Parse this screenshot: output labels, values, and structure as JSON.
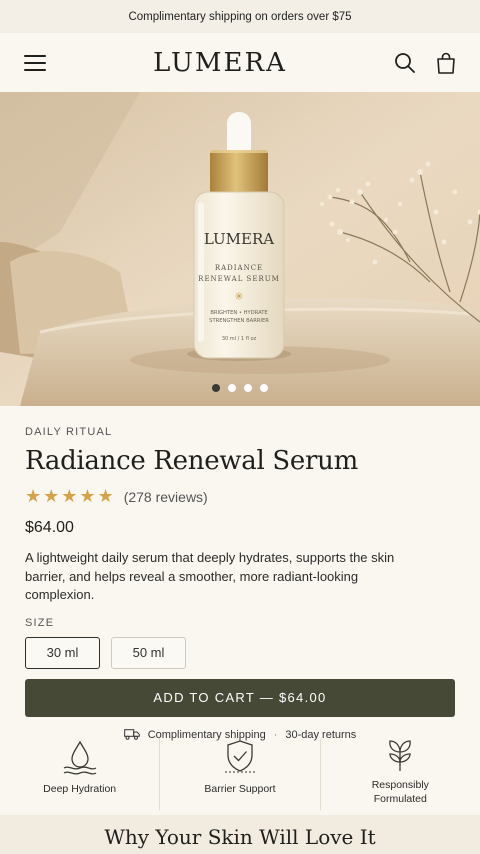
{
  "announcement": "Complimentary shipping on orders over $75",
  "header": {
    "logo": "LUMERA",
    "icons": [
      "menu-icon",
      "search-icon",
      "bag-icon"
    ]
  },
  "hero": {
    "bottle_brand": "LUMERA",
    "bottle_name_line1": "RADIANCE",
    "bottle_name_line2": "RENEWAL SERUM",
    "bottle_claims_line1": "BRIGHTEN • HYDRATE",
    "bottle_claims_line2": "STRENGTHEN BARRIER",
    "bottle_volume": "30 ml / 1 fl oz",
    "slide_count": 4,
    "active_slide": 1
  },
  "product": {
    "eyebrow": "DAILY RITUAL",
    "title": "Radiance Renewal Serum",
    "stars": "★★★★★",
    "rating": 5,
    "reviews": "(278 reviews)",
    "price": "$64.00",
    "description": "A lightweight daily serum that deeply hydrates, supports the skin barrier, and helps reveal a smoother, more radiant-looking complexion.",
    "size_label": "SIZE",
    "sizes": [
      "30 ml",
      "50 ml"
    ],
    "selected_size": "30 ml",
    "cart_label": "ADD TO CART — $64.00",
    "perk_shipping": "Complimentary shipping",
    "perk_separator": "·",
    "perk_returns": "30-day returns"
  },
  "features": [
    {
      "icon": "water-drop-icon",
      "label": "Deep Hydration"
    },
    {
      "icon": "shield-icon",
      "label": "Barrier Support"
    },
    {
      "icon": "leaf-icon",
      "label": "Responsibly Formulated"
    }
  ],
  "section": {
    "title": "Why Your Skin Will Love It"
  },
  "colors": {
    "accent": "#454935",
    "star": "#d6a24a",
    "background": "#faf7f1",
    "bottle_cap": "#c8a45a"
  }
}
